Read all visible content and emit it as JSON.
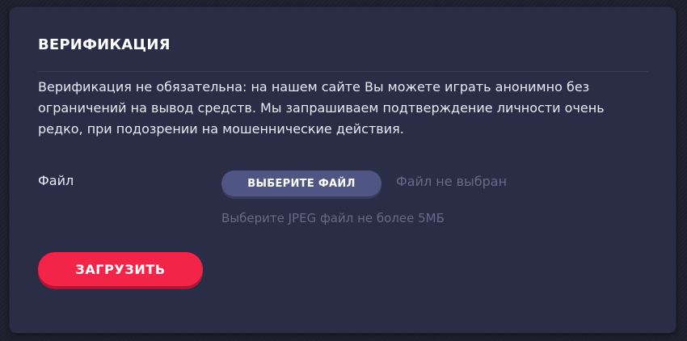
{
  "verification": {
    "title": "ВЕРИФИКАЦИЯ",
    "description": "Верификация не обязательна: на нашем сайте Вы можете играть анонимно без ограничений на вывод средств. Мы запрашиваем подтверждение личности очень редко, при подозрении на мошеннические действия.",
    "file_label": "Файл",
    "choose_file_label": "ВЫБЕРИТЕ ФАЙЛ",
    "file_status": "Файл не выбран",
    "hint": "Выберите JPEG файл не более 5МБ",
    "upload_label": "ЗАГРУЗИТЬ"
  },
  "colors": {
    "background": "#1d1f2d",
    "card": "#292d45",
    "choose_button": "#4f5684",
    "upload_button": "#f22447",
    "muted_text": "#676b8a"
  }
}
